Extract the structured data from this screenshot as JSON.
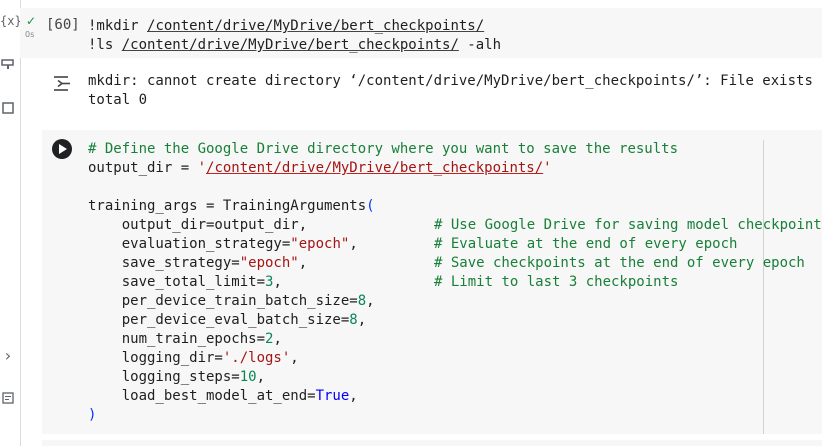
{
  "rail": {
    "top_icon": "{x}",
    "key_icon": "key-icon",
    "folder_icon": "folder-icon",
    "expand_icon": "›",
    "terminal_icon": "terminal-icon"
  },
  "cell1": {
    "status_check": "✓",
    "status_time": "0s",
    "exec_count": "[60]",
    "line1_cmd": "!mkdir ",
    "line1_path": "/content/drive/MyDrive/bert_checkpoints/",
    "line2_cmd": "!ls ",
    "line2_path": "/content/drive/MyDrive/bert_checkpoints/",
    "line2_flag": " -alh"
  },
  "output": {
    "line1": "mkdir: cannot create directory ‘/content/drive/MyDrive/bert_checkpoints/’: File exists",
    "line2": "total 0"
  },
  "cell2": {
    "comment1": "# Define the Google Drive directory where you want to save the results",
    "od_lhs": "output_dir = ",
    "od_q1": "'",
    "od_path": "/content/drive/MyDrive/bert_checkpoints/",
    "od_q2": "'",
    "ta_head": "training_args = TrainingArguments",
    "ta_open": "(",
    "a1": "    output_dir=output_dir,",
    "a1_c": "# Use Google Drive for saving model checkpoint",
    "a2_k": "    evaluation_strategy=",
    "a2_v": "\"epoch\"",
    "a2_e": ",",
    "a2_c": "# Evaluate at the end of every epoch",
    "a3_k": "    save_strategy=",
    "a3_v": "\"epoch\"",
    "a3_e": ",",
    "a3_c": "# Save checkpoints at the end of every epoch",
    "a4_k": "    save_total_limit=",
    "a4_v": "3",
    "a4_e": ",",
    "a4_c": "# Limit to last 3 checkpoints",
    "a5_k": "    per_device_train_batch_size=",
    "a5_v": "8",
    "a5_e": ",",
    "a6_k": "    per_device_eval_batch_size=",
    "a6_v": "8",
    "a6_e": ",",
    "a7_k": "    num_train_epochs=",
    "a7_v": "2",
    "a7_e": ",",
    "a8_k": "    logging_dir=",
    "a8_v": "'./logs'",
    "a8_e": ",",
    "a9_k": "    logging_steps=",
    "a9_v": "10",
    "a9_e": ",",
    "a10_k": "    load_best_model_at_end=",
    "a10_v": "True",
    "a10_e": ",",
    "close": ")"
  },
  "colors": {
    "comment": "#188038",
    "string": "#a31515",
    "number": "#098658",
    "keyword": "#0000ff",
    "cell_bg": "#f7f7f7"
  }
}
